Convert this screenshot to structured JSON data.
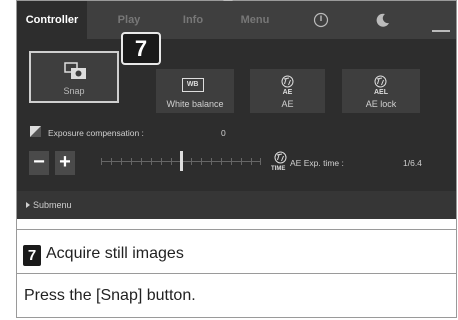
{
  "tabs": [
    {
      "label": "Controller",
      "active": true
    },
    {
      "label": "Play",
      "active": false
    },
    {
      "label": "Info",
      "active": false
    },
    {
      "label": "Menu",
      "active": false
    }
  ],
  "tab_icons": [
    "power-icon",
    "moon-icon",
    "minimize-icon"
  ],
  "snap": {
    "label": "Snap"
  },
  "callout": {
    "number": "7"
  },
  "buttons": {
    "white_balance": {
      "icon_text": "WB",
      "label": "White balance"
    },
    "ae": {
      "icon_text": "AE",
      "label": "AE"
    },
    "ae_lock": {
      "icon_text": "AEL",
      "label": "AE lock"
    }
  },
  "exposure": {
    "label": "Exposure compensation :",
    "value": "0",
    "level_percent": 50
  },
  "stepper": {
    "minus": "−",
    "plus": "+"
  },
  "ae_exp_time": {
    "icon_text": "TIME",
    "label": "AE Exp. time :",
    "value": "1/6.4"
  },
  "submenu": {
    "label": "Submenu"
  },
  "caption": {
    "number": "7",
    "title": "Acquire still images"
  },
  "description": "Press the [Snap] button.",
  "colors": {
    "panel_bg": "#2d2d2d",
    "tab_bar": "#3f3f3f",
    "button_bg": "#3e3e3e",
    "accent_border": "#cfcfcf"
  }
}
